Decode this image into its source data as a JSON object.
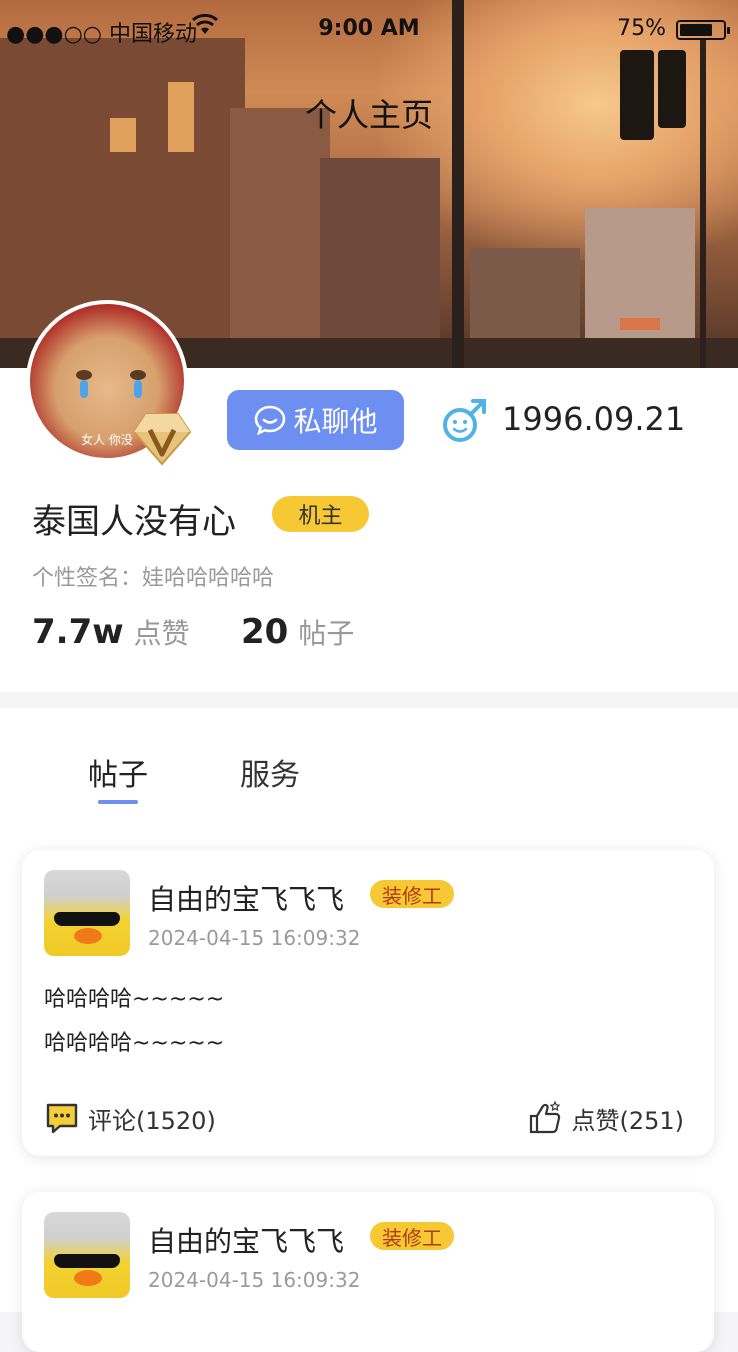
{
  "status_bar": {
    "carrier": "●●●○○ 中国移动",
    "time": "9:00 AM",
    "battery": "75%",
    "battery_level": 0.75
  },
  "header": {
    "title": "个人主页"
  },
  "profile": {
    "avatar_caption": "女人 你没",
    "chat_button": "私聊他",
    "gender_icon": "male-smile-icon",
    "birthday": "1996.09.21",
    "nickname": "泰国人没有心",
    "role_tag": "机主",
    "signature_label": "个性签名：",
    "signature_text": "娃哈哈哈哈哈",
    "likes_count": "7.7w",
    "likes_label": "点赞",
    "posts_count": "20",
    "posts_label": "帖子"
  },
  "tabs": [
    {
      "label": "帖子",
      "active": true
    },
    {
      "label": "服务",
      "active": false
    }
  ],
  "posts": [
    {
      "author": "自由的宝飞飞飞",
      "tag": "装修工",
      "time": "2024-04-15  16:09:32",
      "lines": [
        "哈哈哈哈~~~~~",
        "哈哈哈哈~~~~~"
      ],
      "comments": "评论(1520)",
      "likes": "点赞(251)"
    },
    {
      "author": "自由的宝飞飞飞",
      "tag": "装修工",
      "time": "2024-04-15  16:09:32"
    }
  ],
  "colors": {
    "accent": "#6d8ff2",
    "tag_yellow": "#f6c934",
    "gender_blue": "#4fb3e8"
  }
}
